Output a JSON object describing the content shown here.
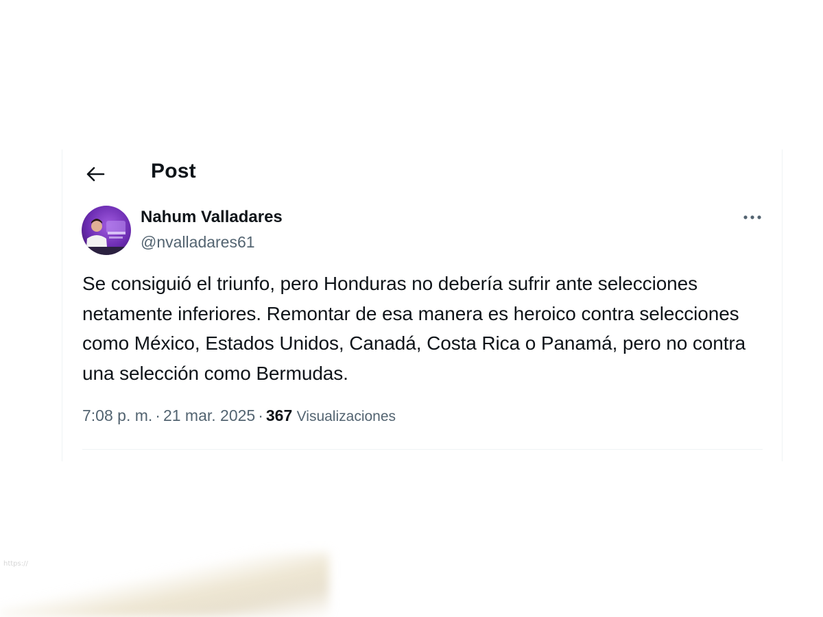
{
  "header": {
    "title": "Post",
    "back_icon": "arrow-left-icon"
  },
  "post": {
    "author": {
      "name": "Nahum Valladares",
      "handle": "@nvalladares61",
      "avatar_icon": "profile-photo"
    },
    "more_icon": "ellipsis-horizontal-icon",
    "text": "Se consiguió el triunfo, pero Honduras no debería sufrir ante selecciones netamente inferiores. Remontar de esa manera es heroico contra selecciones como México, Estados Unidos, Canadá, Costa Rica o Panamá, pero no contra una selección como Bermudas.",
    "time": "7:08 p. m.",
    "date": "21 mar. 2025",
    "separator": "·",
    "views_count": "367",
    "views_label": "Visualizaciones"
  },
  "colors": {
    "primary_text": "#0f1419",
    "secondary_text": "#536471",
    "border": "#eff3f4",
    "avatar_bg": "#6a2bb0"
  },
  "footer": {
    "source_caption": "https://"
  }
}
